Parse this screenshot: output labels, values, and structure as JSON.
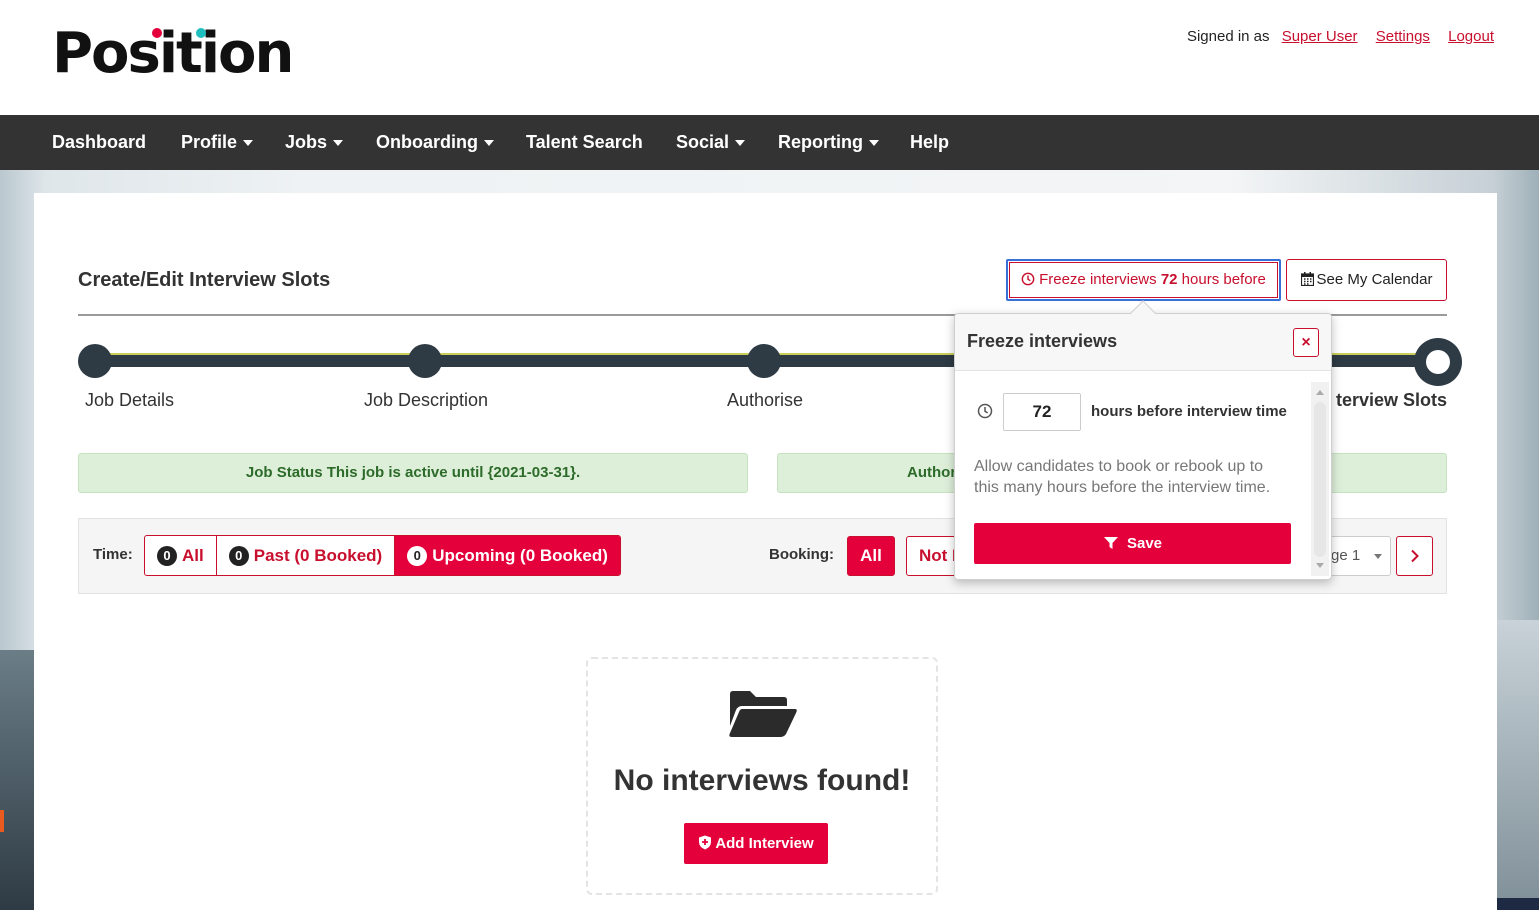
{
  "brand": {
    "logo_text": "Position",
    "accent_red": "#e4003b",
    "teal": "#1fbfbf",
    "nav_bg": "#333333"
  },
  "userbar": {
    "signed_in_label": "Signed in as",
    "user_link": "Super User",
    "settings_link": "Settings",
    "logout_link": "Logout"
  },
  "nav": {
    "dashboard": "Dashboard",
    "profile": "Profile",
    "jobs": "Jobs",
    "onboarding": "Onboarding",
    "talent_search": "Talent Search",
    "social": "Social",
    "reporting": "Reporting",
    "help": "Help"
  },
  "page": {
    "title": "Create/Edit Interview Slots"
  },
  "header_actions": {
    "freeze_prefix": "Freeze interviews",
    "freeze_hours": "72",
    "freeze_suffix": "hours before",
    "calendar_label": "See My Calendar",
    "calendar_icon": "calendar-icon",
    "freeze_icon": "clock-icon"
  },
  "progress": {
    "steps": [
      "Job Details",
      "Job Description",
      "Authorise",
      "Interview Slots"
    ],
    "current_step_visible": "terview Slots"
  },
  "status": {
    "job_status": "Job Status This job is active until {2021-03-31}.",
    "authorisation_partial": "Author"
  },
  "filters": {
    "time_label": "Time:",
    "time_all": "All",
    "time_all_count": "0",
    "time_past": "Past (0 Booked)",
    "time_past_count": "0",
    "time_upcoming": "Upcoming (0 Booked)",
    "time_upcoming_count": "0",
    "booking_label": "Booking:",
    "booking_all": "All",
    "booking_not_partial": "Not I",
    "page_select_partial": "ge 1",
    "next_icon": "chevron-right-icon"
  },
  "empty_state": {
    "icon": "folder-open-icon",
    "message": "No interviews found!",
    "add_button": "Add Interview"
  },
  "popover": {
    "title": "Freeze interviews",
    "close_label": "×",
    "hours_value": "72",
    "hours_label": "hours before interview time",
    "help_text": "Allow candidates to book or rebook up to this many hours before the interview time.",
    "save_label": "Save"
  }
}
